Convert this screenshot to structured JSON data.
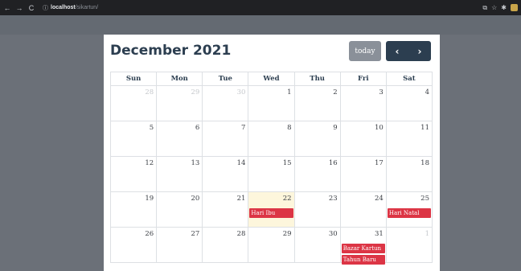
{
  "browser": {
    "host": "localhost",
    "path": "/sikartun/"
  },
  "calendar": {
    "title": "December 2021",
    "today_label": "today",
    "prev_label": "‹",
    "next_label": "›",
    "weekdays": [
      "Sun",
      "Mon",
      "Tue",
      "Wed",
      "Thu",
      "Fri",
      "Sat"
    ],
    "weeks": [
      [
        {
          "d": "28",
          "other": true
        },
        {
          "d": "29",
          "other": true
        },
        {
          "d": "30",
          "other": true
        },
        {
          "d": "1"
        },
        {
          "d": "2"
        },
        {
          "d": "3"
        },
        {
          "d": "4"
        }
      ],
      [
        {
          "d": "5"
        },
        {
          "d": "6"
        },
        {
          "d": "7"
        },
        {
          "d": "8"
        },
        {
          "d": "9"
        },
        {
          "d": "10"
        },
        {
          "d": "11"
        }
      ],
      [
        {
          "d": "12"
        },
        {
          "d": "13"
        },
        {
          "d": "14"
        },
        {
          "d": "15"
        },
        {
          "d": "16"
        },
        {
          "d": "17"
        },
        {
          "d": "18"
        }
      ],
      [
        {
          "d": "19"
        },
        {
          "d": "20"
        },
        {
          "d": "21"
        },
        {
          "d": "22",
          "today": true,
          "events": [
            "Hari Ibu"
          ]
        },
        {
          "d": "23"
        },
        {
          "d": "24"
        },
        {
          "d": "25",
          "events": [
            "Hari Natal"
          ]
        }
      ],
      [
        {
          "d": "26"
        },
        {
          "d": "27"
        },
        {
          "d": "28"
        },
        {
          "d": "29"
        },
        {
          "d": "30"
        },
        {
          "d": "31",
          "events": [
            "Bazar Kartun",
            "Tahun Baru"
          ]
        },
        {
          "d": "1",
          "other": true
        }
      ]
    ]
  },
  "colors": {
    "event": "#dc3545",
    "today_bg": "#fdf6dc",
    "primary": "#2c3e50"
  }
}
